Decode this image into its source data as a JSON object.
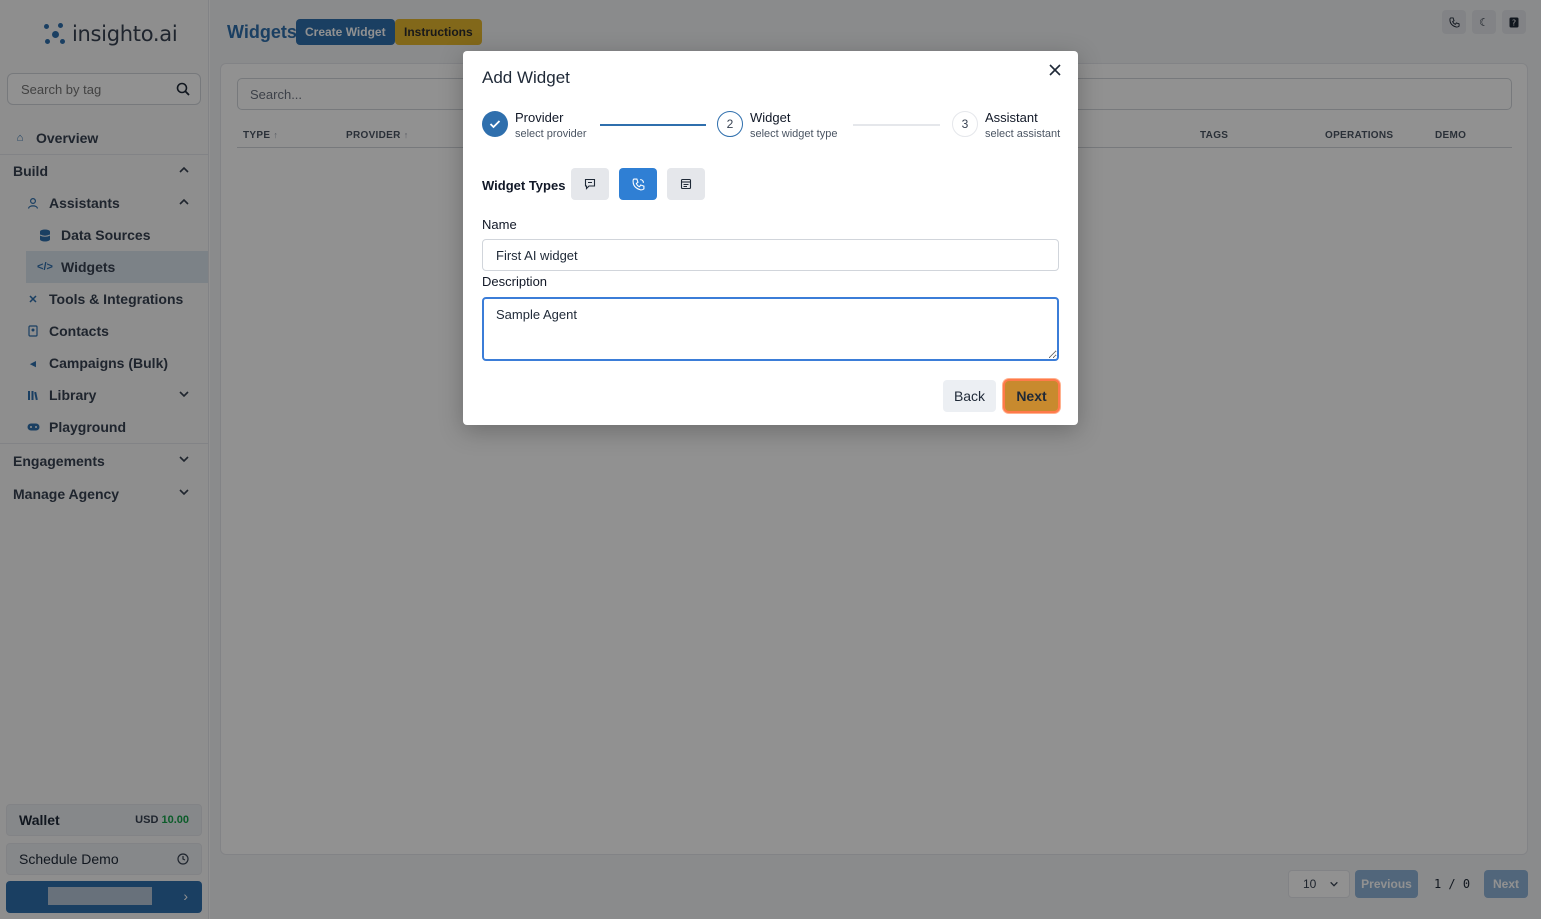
{
  "brand": {
    "name": "insighto.ai"
  },
  "sidebar": {
    "search_placeholder": "Search by tag",
    "items": [
      {
        "label": "Overview"
      },
      {
        "label": "Build"
      },
      {
        "label": "Assistants"
      },
      {
        "label": "Data Sources"
      },
      {
        "label": "Widgets"
      },
      {
        "label": "Tools & Integrations"
      },
      {
        "label": "Contacts"
      },
      {
        "label": "Campaigns (Bulk)"
      },
      {
        "label": "Library"
      },
      {
        "label": "Playground"
      },
      {
        "label": "Engagements"
      },
      {
        "label": "Manage Agency"
      }
    ],
    "wallet": {
      "label": "Wallet",
      "currency": "USD",
      "amount": "10.00"
    },
    "schedule_demo": "Schedule Demo"
  },
  "header": {
    "title": "Widgets",
    "create_button": "Create Widget",
    "instructions_button": "Instructions"
  },
  "table": {
    "search_placeholder": "Search...",
    "columns": [
      "TYPE",
      "PROVIDER",
      "TAGS",
      "OPERATIONS",
      "DEMO"
    ]
  },
  "pagination": {
    "page_size": "10",
    "previous": "Previous",
    "info": "1 / 0",
    "next": "Next"
  },
  "modal": {
    "title": "Add Widget",
    "steps": [
      {
        "number": "1",
        "title": "Provider",
        "subtitle": "select provider",
        "state": "done"
      },
      {
        "number": "2",
        "title": "Widget",
        "subtitle": "select widget type",
        "state": "active"
      },
      {
        "number": "3",
        "title": "Assistant",
        "subtitle": "select assistant",
        "state": "pending"
      }
    ],
    "widget_types_label": "Widget Types",
    "widget_types": [
      {
        "icon": "chat-icon",
        "selected": false
      },
      {
        "icon": "phone-call-icon",
        "selected": true
      },
      {
        "icon": "form-icon",
        "selected": false
      }
    ],
    "name_label": "Name",
    "name_value": "First AI widget",
    "description_label": "Description",
    "description_value": "Sample Agent",
    "back_button": "Back",
    "next_button": "Next"
  },
  "colors": {
    "brand_blue": "#2f6fad",
    "instructions_yellow": "#e5b82f",
    "next_orange": "#c88a2e",
    "wallet_green": "#16a34a"
  }
}
